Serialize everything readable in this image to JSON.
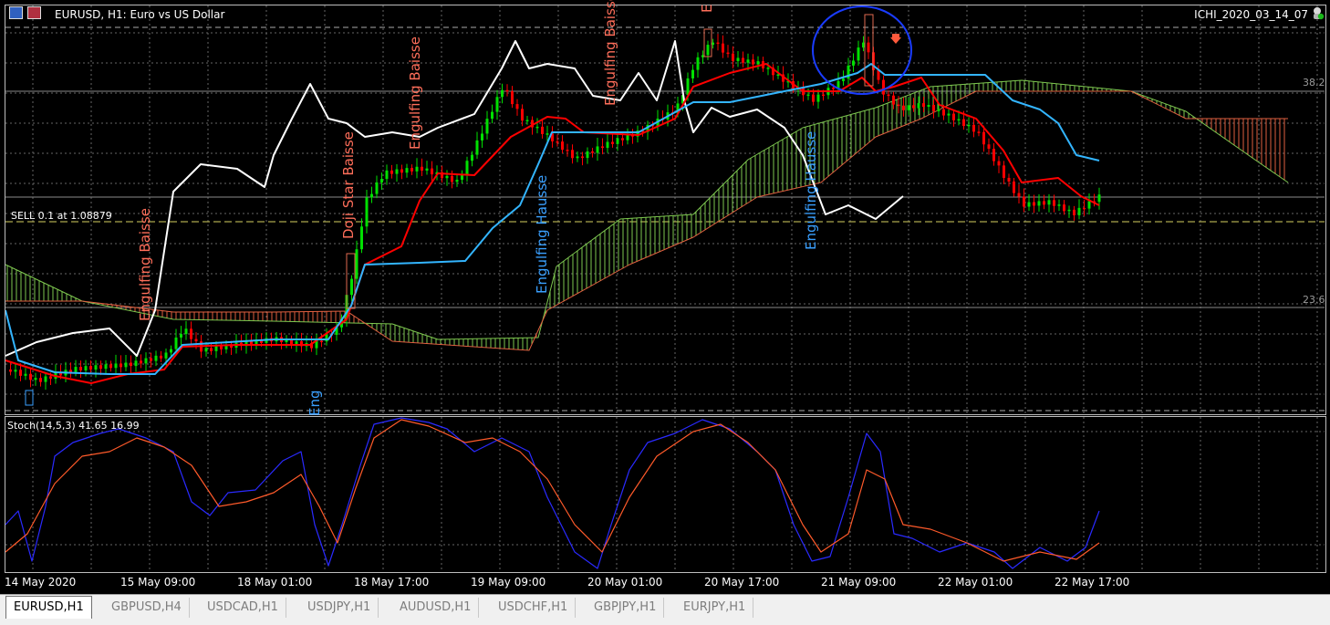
{
  "window": {
    "title": "EURUSD, H1:  Euro vs US Dollar",
    "expert_name": "ICHI_2020_03_14_07",
    "icons": [
      "chart-window-icon",
      "chart-window-icon-2",
      "expert-advisor-icon",
      "sell-arrow-icon"
    ]
  },
  "levels": {
    "fib_382": "38.2",
    "fib_236": "23.6",
    "order_label": "SELL 0.1 at 1.08879"
  },
  "indicator": {
    "stoch_label": "Stoch(14,5,3) 41.65 16.99"
  },
  "patterns": [
    {
      "text": "Engulfing Baisse",
      "color": "#ff6e5a"
    },
    {
      "text": "Doji Star Baisse",
      "color": "#ff6e5a"
    },
    {
      "text": "Engulfing Baisse",
      "color": "#ff6e5a"
    },
    {
      "text": "Engulfing Hausse",
      "color": "#3aa0ff"
    },
    {
      "text": "Engulfing Baisse",
      "color": "#ff6e5a"
    },
    {
      "text": "Engulfing Hausse",
      "color": "#3aa0ff"
    },
    {
      "text": "Eng",
      "color": "#3aa0ff"
    },
    {
      "text": "E",
      "color": "#ff6e5a"
    }
  ],
  "time_axis": [
    "14 May 2020",
    "15 May 09:00",
    "18 May 01:00",
    "18 May 17:00",
    "19 May 09:00",
    "20 May 01:00",
    "20 May 17:00",
    "21 May 09:00",
    "22 May 01:00",
    "22 May 17:00"
  ],
  "tabs": [
    {
      "label": "EURUSD,H1",
      "active": true
    },
    {
      "label": "GBPUSD,H4",
      "active": false
    },
    {
      "label": "USDCAD,H1",
      "active": false
    },
    {
      "label": "USDJPY,H1",
      "active": false
    },
    {
      "label": "AUDUSD,H1",
      "active": false
    },
    {
      "label": "USDCHF,H1",
      "active": false
    },
    {
      "label": "GBPJPY,H1",
      "active": false
    },
    {
      "label": "EURJPY,H1",
      "active": false
    }
  ],
  "colors": {
    "background": "#000000",
    "bull_candle": "#00e000",
    "bear_candle": "#ff0000",
    "tenkan": "#ff0000",
    "kijun": "#33b5ff",
    "chikou": "#ffffff",
    "kumo_bull": "#7ec850",
    "kumo_bear": "#e06040",
    "stoch_main": "#2a2aff",
    "stoch_signal": "#ff5a2a",
    "circle": "#1a3cff"
  }
}
